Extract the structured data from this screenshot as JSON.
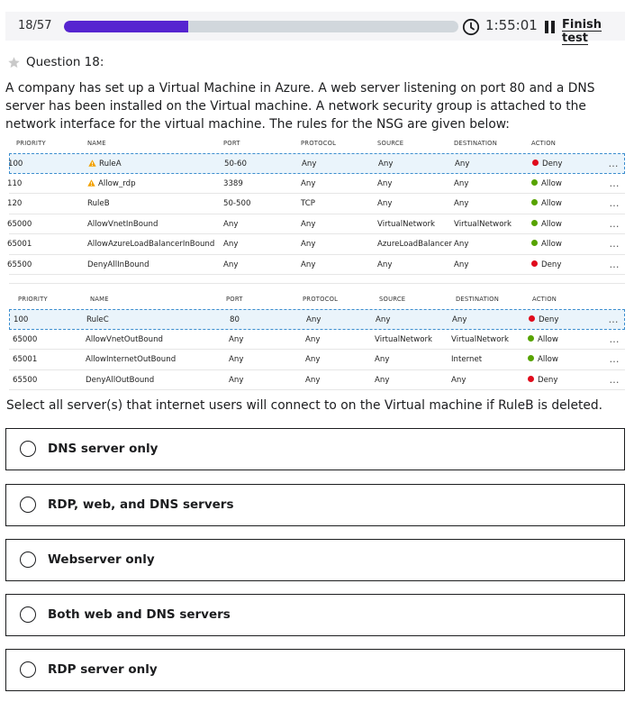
{
  "topbar": {
    "counter": "18/57",
    "progress_fraction": 0.3158,
    "timer": "1:55:01",
    "finish_label": "Finish test"
  },
  "question": {
    "label": "Question 18:",
    "text": "A company has set up a Virtual Machine in Azure. A web server listening on port 80 and a DNS server has been installed on the Virtual machine. A network security group is attached to the network interface for the virtual machine. The rules for the NSG are given below:",
    "prompt": "Select all server(s) that internet users will connect to on the Virtual machine if RuleB is deleted."
  },
  "inbound": {
    "headers": [
      "PRIORITY",
      "NAME",
      "PORT",
      "PROTOCOL",
      "SOURCE",
      "DESTINATION",
      "ACTION"
    ],
    "rows": [
      {
        "priority": "100",
        "name": "RuleA",
        "warn": true,
        "port": "50-60",
        "protocol": "Any",
        "source": "Any",
        "destination": "Any",
        "action": "Deny"
      },
      {
        "priority": "110",
        "name": "Allow_rdp",
        "warn": true,
        "port": "3389",
        "protocol": "Any",
        "source": "Any",
        "destination": "Any",
        "action": "Allow"
      },
      {
        "priority": "120",
        "name": "RuleB",
        "warn": false,
        "port": "50-500",
        "protocol": "TCP",
        "source": "Any",
        "destination": "Any",
        "action": "Allow"
      },
      {
        "priority": "65000",
        "name": "AllowVnetInBound",
        "warn": false,
        "port": "Any",
        "protocol": "Any",
        "source": "VirtualNetwork",
        "destination": "VirtualNetwork",
        "action": "Allow"
      },
      {
        "priority": "65001",
        "name": "AllowAzureLoadBalancerInBound",
        "warn": false,
        "port": "Any",
        "protocol": "Any",
        "source": "AzureLoadBalancer",
        "destination": "Any",
        "action": "Allow"
      },
      {
        "priority": "65500",
        "name": "DenyAllInBound",
        "warn": false,
        "port": "Any",
        "protocol": "Any",
        "source": "Any",
        "destination": "Any",
        "action": "Deny"
      }
    ]
  },
  "outbound": {
    "headers": [
      "PRIORITY",
      "NAME",
      "PORT",
      "PROTOCOL",
      "SOURCE",
      "DESTINATION",
      "ACTION"
    ],
    "rows": [
      {
        "priority": "100",
        "name": "RuleC",
        "warn": false,
        "port": "80",
        "protocol": "Any",
        "source": "Any",
        "destination": "Any",
        "action": "Deny"
      },
      {
        "priority": "65000",
        "name": "AllowVnetOutBound",
        "warn": false,
        "port": "Any",
        "protocol": "Any",
        "source": "VirtualNetwork",
        "destination": "VirtualNetwork",
        "action": "Allow"
      },
      {
        "priority": "65001",
        "name": "AllowInternetOutBound",
        "warn": false,
        "port": "Any",
        "protocol": "Any",
        "source": "Any",
        "destination": "Internet",
        "action": "Allow"
      },
      {
        "priority": "65500",
        "name": "DenyAllOutBound",
        "warn": false,
        "port": "Any",
        "protocol": "Any",
        "source": "Any",
        "destination": "Any",
        "action": "Deny"
      }
    ]
  },
  "options": [
    "DNS server only",
    "RDP, web, and DNS servers",
    "Webserver only",
    "Both web and DNS servers",
    "RDP server only"
  ],
  "colors": {
    "progress": "#5624d0",
    "deny": "#e00b1c",
    "allow": "#57a300",
    "warning": "#f2a100",
    "selected_row": "#eaf4fb"
  }
}
